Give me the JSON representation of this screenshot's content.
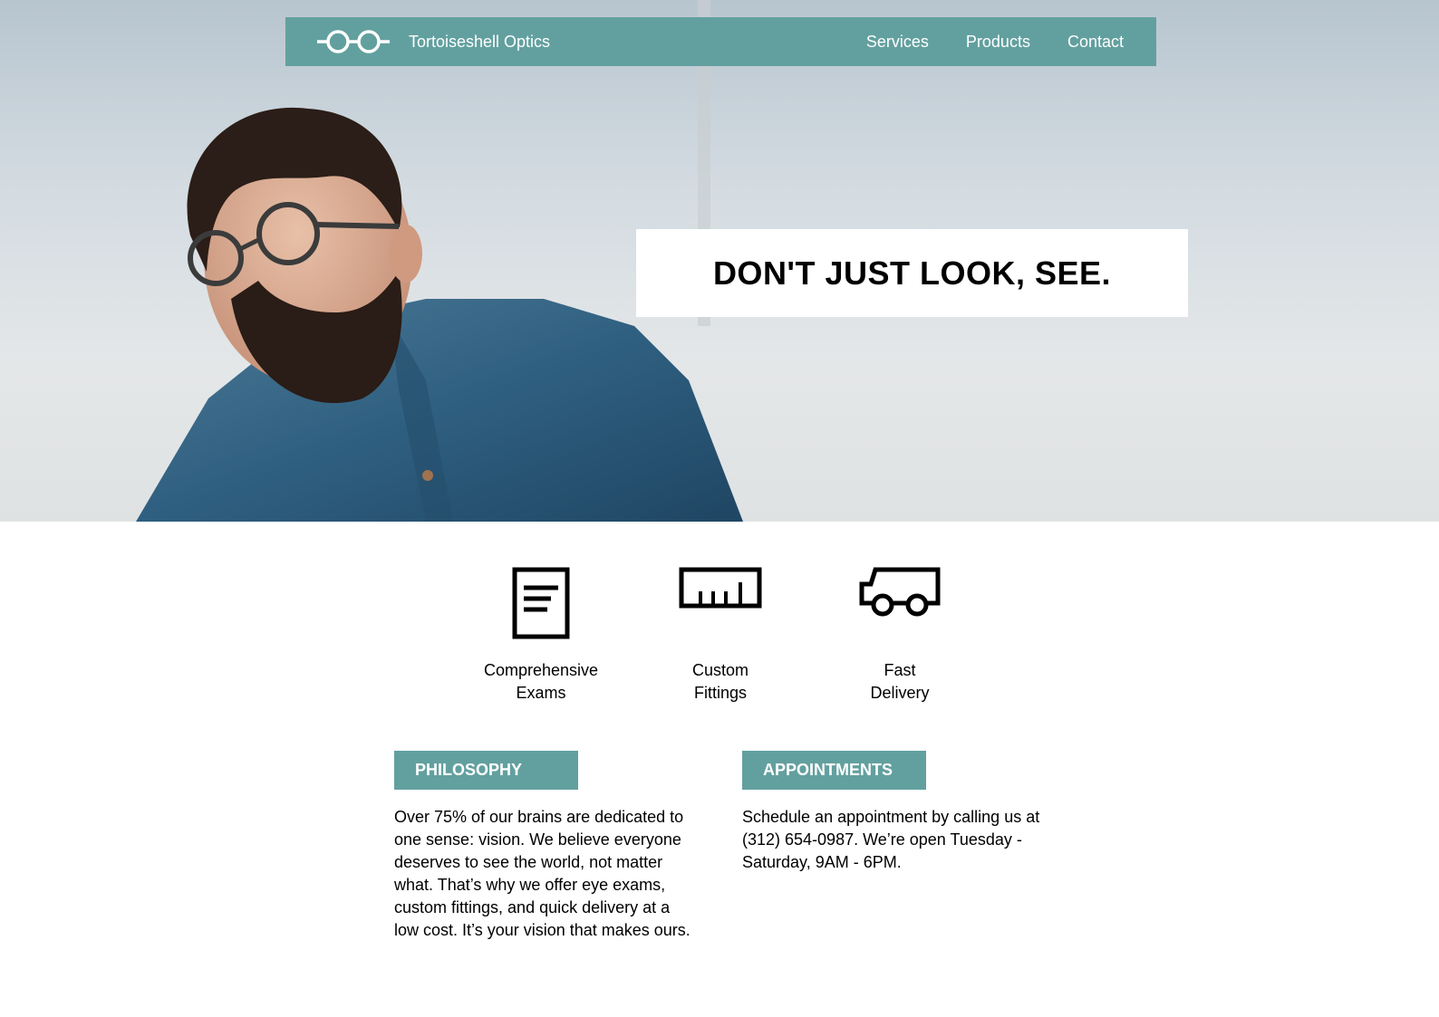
{
  "colors": {
    "accent": "#62a09f",
    "hero_box": "#ffffff",
    "text": "#000000"
  },
  "header": {
    "logo_icon": "eyeglasses-icon",
    "brand_name": "Tortoiseshell Optics",
    "nav": [
      {
        "label": "Services"
      },
      {
        "label": "Products"
      },
      {
        "label": "Contact"
      }
    ]
  },
  "hero": {
    "image": "man-with-glasses-photo",
    "headline": "DON'T JUST LOOK, SEE."
  },
  "features": [
    {
      "icon": "document-icon",
      "line1": "Comprehensive",
      "line2": "Exams"
    },
    {
      "icon": "ruler-icon",
      "line1": "Custom",
      "line2": "Fittings"
    },
    {
      "icon": "truck-icon",
      "line1": "Fast",
      "line2": "Delivery"
    }
  ],
  "philosophy": {
    "heading": "PHILOSOPHY",
    "lines": [
      "Over 75% of our brains are dedicated to",
      "one sense: vision. We believe everyone",
      "deserves to see the world, not matter",
      "what. That’s why we offer eye exams,",
      "custom fittings, and quick delivery at a",
      "low cost. It’s your vision that makes ours."
    ]
  },
  "appointments": {
    "heading": "APPOINTMENTS",
    "lines": [
      "Schedule an appointment by calling us at",
      "(312) 654-0987. We’re open Tuesday -",
      "Saturday, 9AM - 6PM."
    ]
  }
}
